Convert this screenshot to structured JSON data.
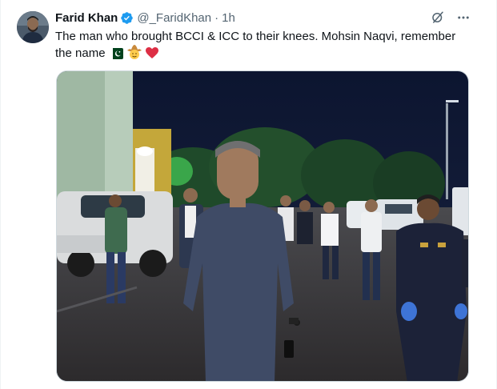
{
  "author": {
    "display_name": "Farid Khan",
    "handle": "@_FaridKhan",
    "separator": "·",
    "time": "1h",
    "verified": true
  },
  "tweet": {
    "text": "The man who brought BCCI & ICC to their knees. Mohsin Naqvi, remember the name",
    "emojis": [
      "pakistan-flag-emoji",
      "cowboy-face-emoji",
      "red-heart-emoji"
    ]
  },
  "icons": {
    "verified": "verified-badge-icon",
    "grok": "grok-icon",
    "more": "more-options-icon"
  },
  "colors": {
    "verified_blue": "#1d9bf0",
    "secondary_text": "#536471",
    "primary_text": "#0f1419"
  }
}
